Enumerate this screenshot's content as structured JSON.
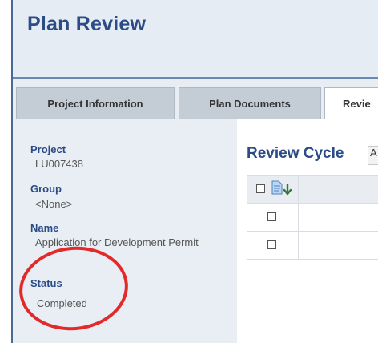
{
  "app": {
    "title": "Plan Review"
  },
  "tabs": [
    {
      "label": "Project Information"
    },
    {
      "label": "Plan Documents"
    },
    {
      "label": "Revie"
    }
  ],
  "fields": [
    {
      "label": "Project",
      "value": "LU007438"
    },
    {
      "label": "Group",
      "value": "<None>"
    },
    {
      "label": "Name",
      "value": "Application for Development Permit"
    },
    {
      "label": "Status",
      "value": "Completed"
    }
  ],
  "review_cycle": {
    "title": "Review Cycle",
    "select_value": "A",
    "rows": 2
  },
  "icons": {
    "header_doc": "document-icon",
    "header_download": "download-arrow-icon"
  },
  "colors": {
    "title_blue": "#2b4c86",
    "annotation_red": "#e32a2a",
    "download_green": "#2e7d32"
  }
}
